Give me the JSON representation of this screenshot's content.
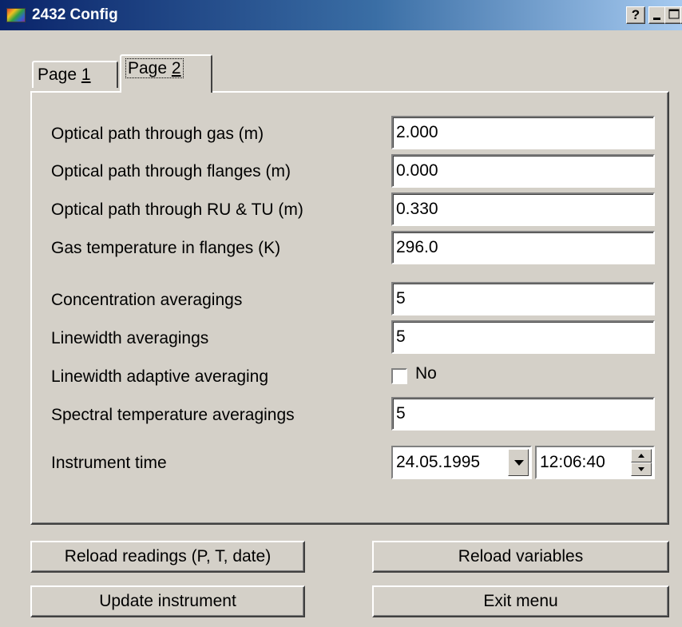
{
  "window": {
    "title": "2432 Config",
    "help_button": "?",
    "minimize_icon": "minimize-icon",
    "maximize_icon": "maximize-icon",
    "close_icon": "close-icon",
    "app_icon": "app-icon"
  },
  "tabs": [
    {
      "prefix": "Page ",
      "accel": "1",
      "active": false
    },
    {
      "prefix": "Page ",
      "accel": "2",
      "active": true
    }
  ],
  "fields": {
    "gas_path": {
      "label": "Optical path through gas (m)",
      "value": "2.000"
    },
    "flange_path": {
      "label": "Optical path through flanges (m)",
      "value": "0.000"
    },
    "ru_tu_path": {
      "label": "Optical path through RU & TU (m)",
      "value": "0.330"
    },
    "gas_temp": {
      "label": "Gas temperature in flanges (K)",
      "value": "296.0"
    },
    "conc_avg": {
      "label": "Concentration averagings",
      "value": "5"
    },
    "lw_avg": {
      "label": "Linewidth averagings",
      "value": "5"
    },
    "lw_adaptive": {
      "label": "Linewidth adaptive averaging",
      "checked": false,
      "value_label": "No"
    },
    "spec_temp_avg": {
      "label": "Spectral temperature averagings",
      "value": "5"
    },
    "instrument_time": {
      "label": "Instrument time",
      "date": "24.05.1995",
      "time": "12:06:40"
    }
  },
  "buttons": {
    "reload_readings": "Reload readings (P, T, date)",
    "reload_variables": "Reload variables",
    "update_instrument": "Update instrument",
    "exit_menu": "Exit menu"
  }
}
